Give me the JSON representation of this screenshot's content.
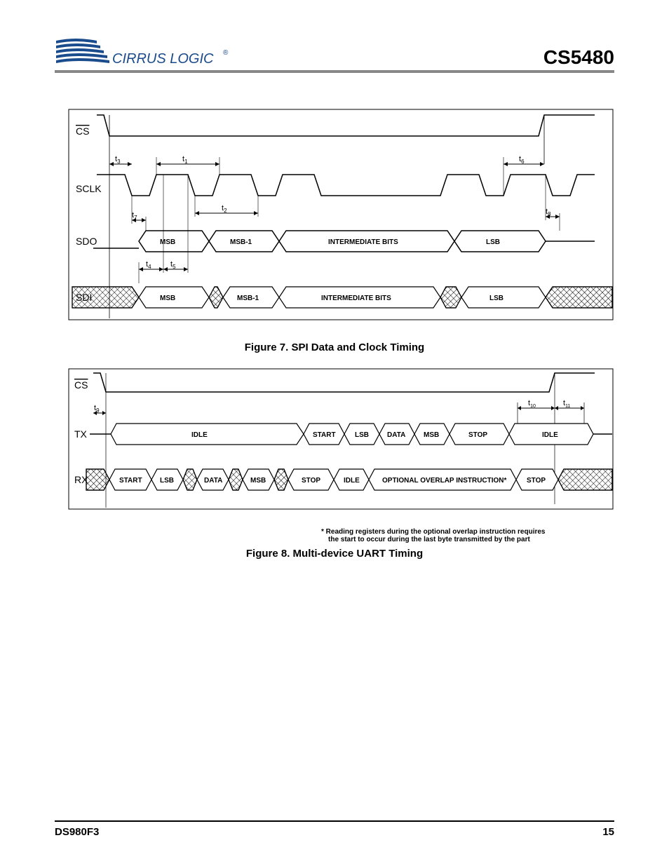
{
  "header": {
    "company": "CIRRUS LOGIC",
    "reg": "®",
    "part": "CS5480"
  },
  "fig7": {
    "caption": "Figure 7.  SPI Data and Clock Timing",
    "signals": {
      "cs": "CS",
      "sclk": "SCLK",
      "sdo": "SDO",
      "sdi": "SDI"
    },
    "bits": {
      "msb": "MSB",
      "msb1": "MSB-1",
      "inter": "INTERMEDIATE BITS",
      "lsb": "LSB"
    },
    "t": {
      "t1": "t",
      "t1s": "1",
      "t2": "t",
      "t2s": "2",
      "t3": "t",
      "t3s": "3",
      "t4": "t",
      "t4s": "4",
      "t5": "t",
      "t5s": "5",
      "t6": "t",
      "t6s": "6",
      "t7": "t",
      "t7s": "7",
      "t8": "t",
      "t8s": "8"
    }
  },
  "fig8": {
    "caption": "Figure 8.  Multi-device UART Timing",
    "signals": {
      "cs": "CS",
      "tx": "TX",
      "rx": "RX"
    },
    "tx_bits": {
      "idle": "IDLE",
      "start": "START",
      "lsb": "LSB",
      "data": "DATA",
      "msb": "MSB",
      "stop": "STOP",
      "idle2": "IDLE"
    },
    "rx_bits": {
      "start": "START",
      "lsb": "LSB",
      "data": "DATA",
      "msb": "MSB",
      "stop": "STOP",
      "idle": "IDLE",
      "overlap": "OPTIONAL OVERLAP INSTRUCTION*",
      "stop2": "STOP"
    },
    "t": {
      "t9": "t",
      "t9s": "9",
      "t10": "t",
      "t10s": "10",
      "t11": "t",
      "t11s": "11"
    },
    "footnote1": "* Reading registers during the optional overlap instruction requires",
    "footnote2": "the start to occur during the last byte transmitted by the part"
  },
  "footer": {
    "doc": "DS980F3",
    "page": "15"
  }
}
